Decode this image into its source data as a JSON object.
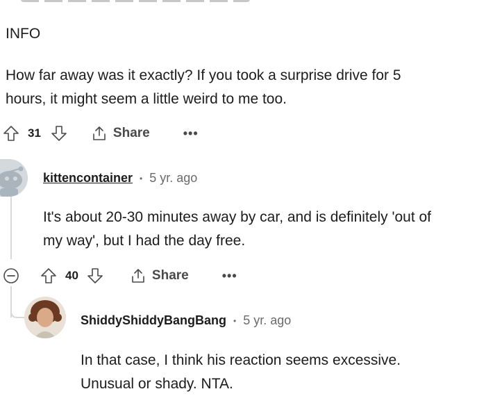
{
  "top_comment": {
    "heading": "INFO",
    "body_line1": "How far away was it exactly? If you took a surprise drive for 5",
    "body_line2": "hours, it might seem a little weird to me too.",
    "votes": "31",
    "share_label": "Share",
    "more_label": "•••"
  },
  "reply1": {
    "username": "kittencontainer",
    "separator": "•",
    "age": "5 yr. ago",
    "body_line1": "It's about 20-30 minutes away by car, and is definitely 'out of",
    "body_line2": "my way', but I had the day free.",
    "votes": "40",
    "share_label": "Share",
    "more_label": "•••"
  },
  "reply2": {
    "username": "ShiddyShiddyBangBang",
    "separator": "•",
    "age": "5 yr. ago",
    "body_line1": "In that case, I think his reaction seems excessive.",
    "body_line2": "Unusual or shady. NTA."
  },
  "icons": {
    "upvote": "arrow-up-outline-icon",
    "downvote": "arrow-down-outline-icon",
    "share": "share-upload-icon",
    "collapse": "collapse-minus-circle-icon"
  },
  "colors": {
    "text": "#1c1c1c",
    "muted": "#6a6a6a",
    "icon": "#4a4a4a",
    "thread_line": "#d8d8d8"
  }
}
